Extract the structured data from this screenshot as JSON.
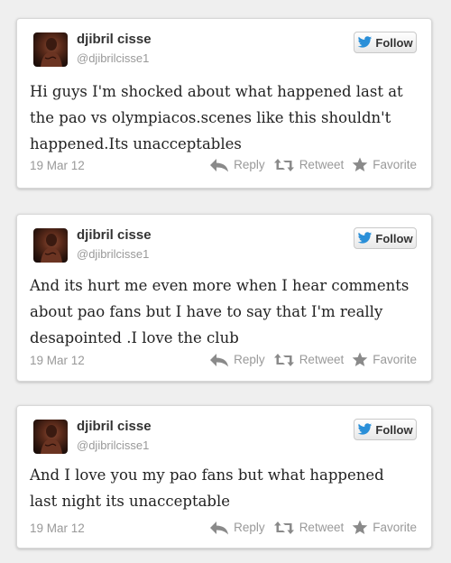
{
  "colors": {
    "follow_bird": "#2a8fd8",
    "action_icon": "#8a8a8a",
    "muted_text": "#999999"
  },
  "tweets": [
    {
      "name": "djibril cisse",
      "handle": "@djibrilcisse1",
      "follow_label": "Follow",
      "text": "Hi guys I'm shocked about what happened last at the pao vs olympiacos.scenes like this shouldn't happened.Its unacceptables",
      "date": "19 Mar 12",
      "reply_label": "Reply",
      "retweet_label": "Retweet",
      "favorite_label": "Favorite"
    },
    {
      "name": "djibril cisse",
      "handle": "@djibrilcisse1",
      "follow_label": "Follow",
      "text": "And its hurt me even more when I hear comments about pao fans but I have to say that I'm really desapointed .I love the club",
      "date": "19 Mar 12",
      "reply_label": "Reply",
      "retweet_label": "Retweet",
      "favorite_label": "Favorite"
    },
    {
      "name": "djibril cisse",
      "handle": "@djibrilcisse1",
      "follow_label": "Follow",
      "text": "And I love you my pao fans but what happened last night its unacceptable",
      "date": "19 Mar 12",
      "reply_label": "Reply",
      "retweet_label": "Retweet",
      "favorite_label": "Favorite"
    }
  ]
}
